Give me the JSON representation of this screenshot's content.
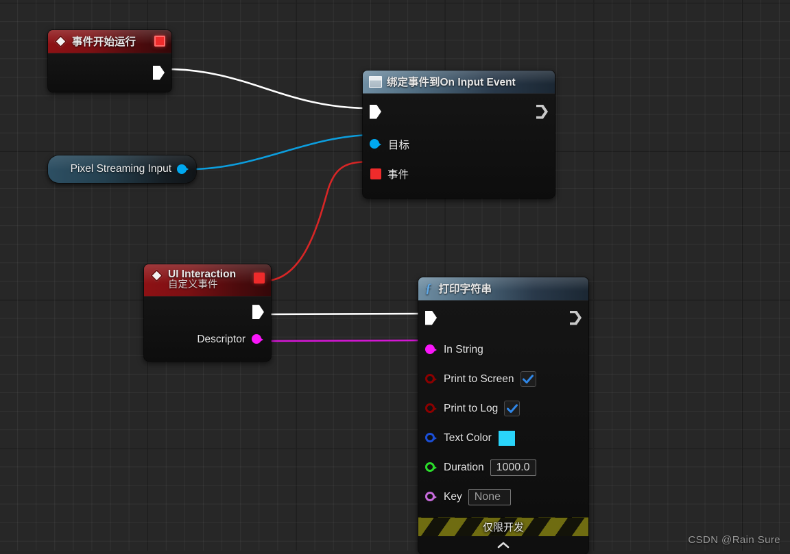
{
  "watermark": "CSDN @Rain Sure",
  "colors": {
    "exec_white": "#ffffff",
    "object_blue": "#00a8f0",
    "delegate_red": "#ef2b2b",
    "string_magenta": "#f916f9",
    "bool_darkred": "#8c0000",
    "linear_color_blue": "#1b4fd8",
    "float_green": "#2bdc2b",
    "name_violet": "#c76bdc",
    "dev_banner": "#6f6c11",
    "text_color_value": "#2ad4fa"
  },
  "nodes": {
    "event_begin_play": {
      "title": "事件开始运行",
      "icon": "event-diamond-icon",
      "delegate_pin_name": "delegate-pin",
      "exec_out": {
        "label": "",
        "pin": "exec-out-pin"
      }
    },
    "bind_event": {
      "title_prefix": "绑定事件到",
      "title": "绑定事件到On Input Event",
      "icon": "bind-event-icon",
      "pins": [
        {
          "name": "exec-in",
          "label": "",
          "type": "exec",
          "connected": true
        },
        {
          "name": "exec-out",
          "label": "",
          "type": "exec-out",
          "connected": false
        },
        {
          "name": "target",
          "label": "目标",
          "type": "object",
          "connected": true
        },
        {
          "name": "event",
          "label": "事件",
          "type": "delegate",
          "connected": true
        }
      ]
    },
    "pixel_streaming_input": {
      "title": "Pixel Streaming Input",
      "output_pin": "object-output-pin"
    },
    "ui_interaction": {
      "title": "UI Interaction",
      "subtitle": "自定义事件",
      "icon": "event-diamond-icon",
      "delegate_pin_name": "delegate-out-pin",
      "pins": [
        {
          "name": "exec-out",
          "label": "",
          "type": "exec-out",
          "connected": true
        },
        {
          "name": "descriptor",
          "label": "Descriptor",
          "type": "string",
          "connected": true
        }
      ]
    },
    "print_string": {
      "title": "打印字符串",
      "icon": "function-icon",
      "pins": [
        {
          "name": "exec-in",
          "label": "",
          "type": "exec",
          "connected": true
        },
        {
          "name": "exec-out",
          "label": "",
          "type": "exec-out",
          "connected": false
        },
        {
          "name": "in-string",
          "label": "In String",
          "type": "string",
          "connected": true
        },
        {
          "name": "print-to-screen",
          "label": "Print to Screen",
          "type": "bool",
          "connected": false,
          "value": true
        },
        {
          "name": "print-to-log",
          "label": "Print to Log",
          "type": "bool",
          "connected": false,
          "value": true
        },
        {
          "name": "text-color",
          "label": "Text Color",
          "type": "linearcolor",
          "connected": false,
          "value": "#2ad4fa"
        },
        {
          "name": "duration",
          "label": "Duration",
          "type": "float",
          "connected": false,
          "value": "1000.0"
        },
        {
          "name": "key",
          "label": "Key",
          "type": "name",
          "connected": false,
          "value": "None"
        }
      ],
      "dev_banner": "仅限开发",
      "collapse": "chevron-up"
    }
  }
}
